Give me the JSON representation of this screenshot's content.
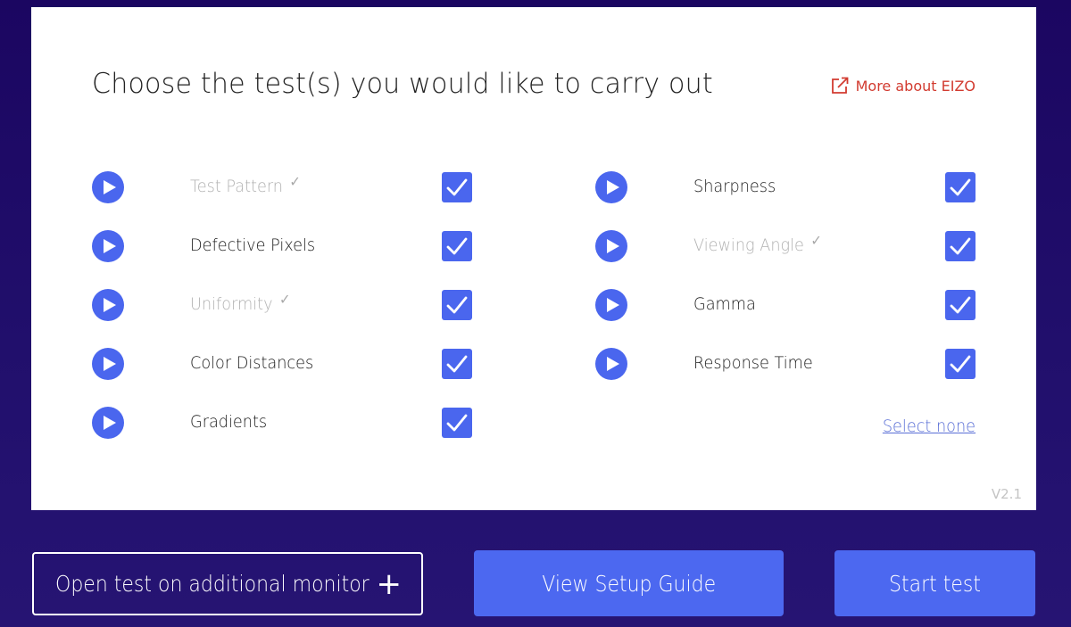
{
  "card": {
    "title": "Choose the test(s) you would like to carry out",
    "more_link": {
      "label": "More about EIZO",
      "icon": "external-link-icon"
    },
    "tests_left": [
      {
        "label": "Test Pattern",
        "completed": true,
        "selected": true
      },
      {
        "label": "Defective Pixels",
        "completed": false,
        "selected": true
      },
      {
        "label": "Uniformity",
        "completed": true,
        "selected": true
      },
      {
        "label": "Color Distances",
        "completed": false,
        "selected": true
      },
      {
        "label": "Gradients",
        "completed": false,
        "selected": true
      }
    ],
    "tests_right": [
      {
        "label": "Sharpness",
        "completed": false,
        "selected": true
      },
      {
        "label": "Viewing Angle",
        "completed": true,
        "selected": true
      },
      {
        "label": "Gamma",
        "completed": false,
        "selected": true
      },
      {
        "label": "Response Time",
        "completed": false,
        "selected": true
      }
    ],
    "completed_mark": "✓",
    "select_none_label": "Select none",
    "version": "V2.1"
  },
  "footer": {
    "additional_monitor_label": "Open test on additional monitor",
    "additional_monitor_icon": "+",
    "setup_guide_label": "View Setup Guide",
    "start_label": "Start test"
  },
  "colors": {
    "accent": "#4a66ee",
    "link_red": "#d23b30",
    "background": "#1b0661",
    "completed_text": "#b2b2b2"
  }
}
